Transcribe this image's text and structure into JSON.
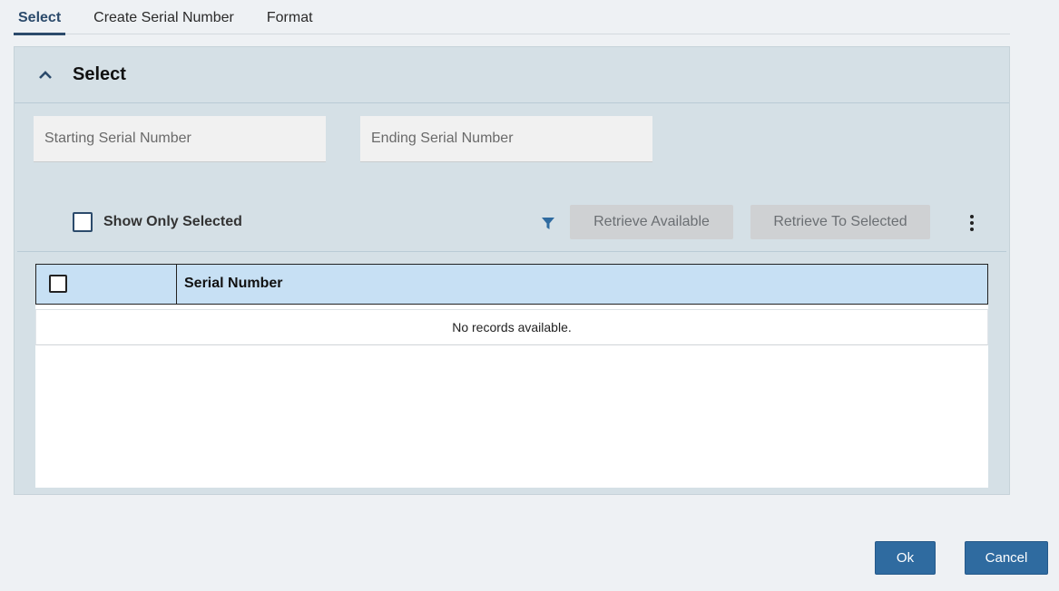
{
  "tabs": [
    {
      "label": "Select",
      "active": true
    },
    {
      "label": "Create Serial Number",
      "active": false
    },
    {
      "label": "Format",
      "active": false
    }
  ],
  "panel": {
    "title": "Select",
    "starting_serial_placeholder": "Starting Serial Number",
    "ending_serial_placeholder": "Ending Serial Number",
    "show_only_selected_label": "Show Only Selected",
    "show_only_selected_checked": false,
    "retrieve_available_label": "Retrieve Available",
    "retrieve_to_selected_label": "Retrieve To Selected"
  },
  "grid": {
    "columns": [
      "Serial Number"
    ],
    "empty_message": "No records available."
  },
  "footer": {
    "ok_label": "Ok",
    "cancel_label": "Cancel"
  },
  "colors": {
    "accent": "#2b4a6b",
    "primary_button": "#2f6ba0",
    "panel_bg": "#d5e0e6",
    "grid_header_bg": "#c7e0f4"
  },
  "icons": [
    "chevron-up-icon",
    "filter-icon",
    "kebab-menu-icon"
  ]
}
